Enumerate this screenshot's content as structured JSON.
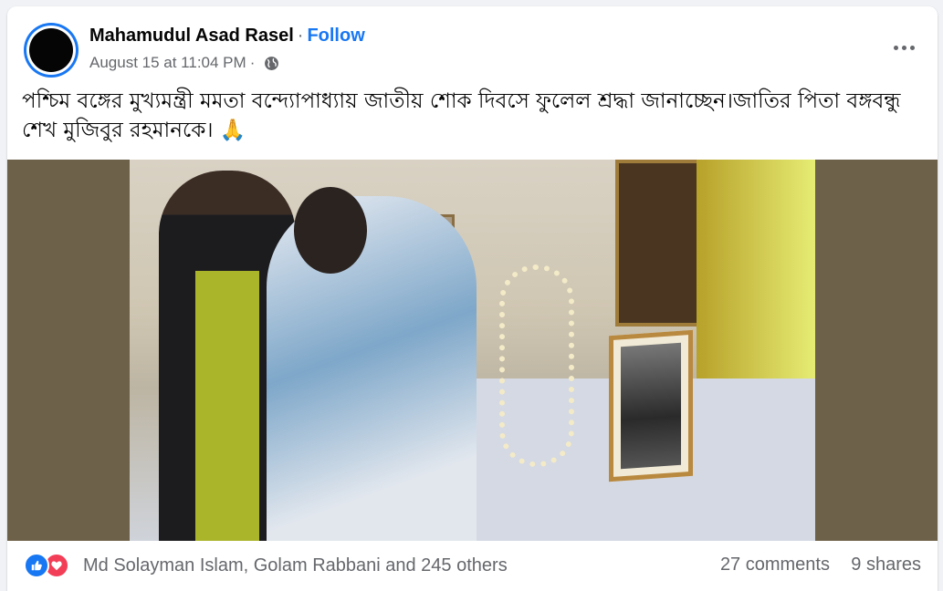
{
  "post": {
    "author": "Mahamudul Asad Rasel",
    "separator": "·",
    "follow_label": "Follow",
    "timestamp": "August 15 at 11:04 PM",
    "meta_separator": "·",
    "privacy_icon": "globe-icon",
    "more_icon": "more-options-icon",
    "text": "পশ্চিম বঙ্গের মুখ্যমন্ত্রী মমতা বন্দ্যোপাধ্যায় জাতীয় শোক দিবসে ফুলেল শ্রদ্ধা জানাচ্ছেন।জাতির পিতা বঙ্গবন্ধু শেখ মুজিবুর রহমানকে। 🙏"
  },
  "engagement": {
    "reaction_icons": [
      "like-icon",
      "love-icon"
    ],
    "reactors": "Md Solayman Islam, Golam Rabbani and 245 others",
    "comments": "27 comments",
    "shares": "9 shares"
  },
  "colors": {
    "brand_blue": "#1877f2",
    "love_red": "#f33e58",
    "secondary_text": "#65676b",
    "media_background": "#6d6149"
  }
}
